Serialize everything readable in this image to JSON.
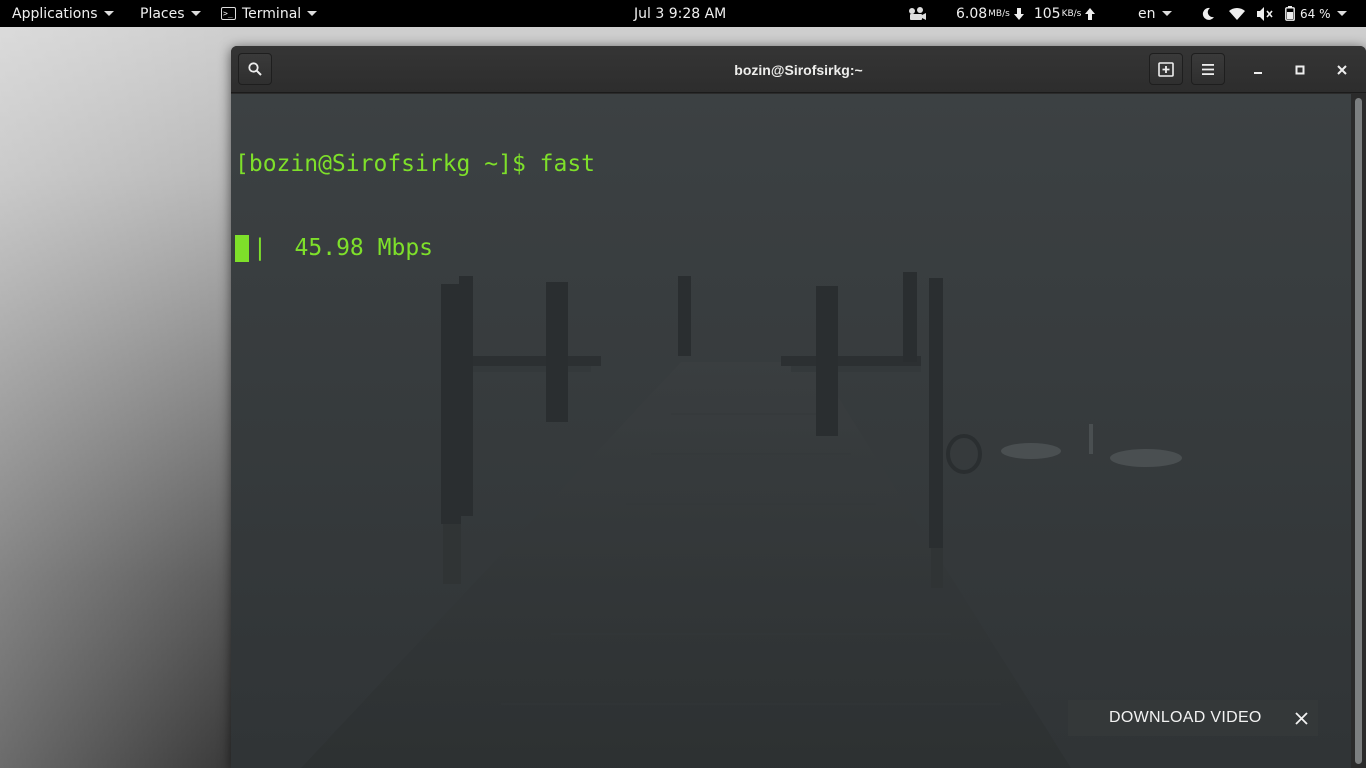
{
  "topbar": {
    "applications": "Applications",
    "places": "Places",
    "terminal": "Terminal",
    "clock": "Jul 3   9:28 AM",
    "download_speed": "6.08",
    "download_unit": "MB/s",
    "upload_speed": "105",
    "upload_unit": "KB/s",
    "language": "en",
    "battery": "64 %"
  },
  "window": {
    "title": "bozin@Sirofsirkg:~"
  },
  "terminal": {
    "prompt_line": "[bozin@Sirofsirkg ~]$ fast",
    "output_line": "|  45.98 Mbps"
  },
  "download_banner": {
    "label": "DOWNLOAD VIDEO"
  },
  "colors": {
    "terminal_text": "#7ee02a",
    "terminal_bg": "#363b3d",
    "topbar_bg": "#000000"
  }
}
